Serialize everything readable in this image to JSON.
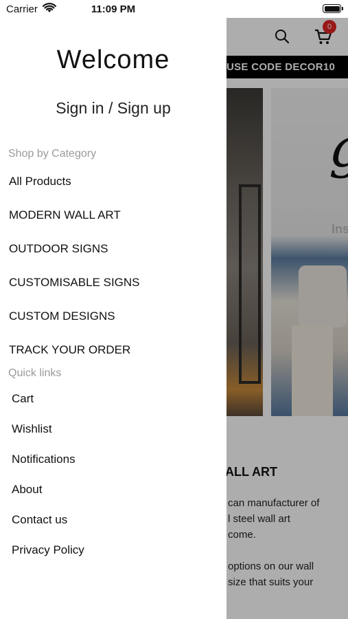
{
  "status_bar": {
    "carrier": "Carrier",
    "time": "11:09 PM"
  },
  "drawer": {
    "welcome": "Welcome",
    "signin": "Sign in / Sign up",
    "shop_by_category_title": "Shop by Category",
    "categories": [
      "All Products",
      "MODERN WALL ART",
      "OUTDOOR SIGNS",
      "CUSTOMISABLE SIGNS",
      "CUSTOM DESIGNS",
      "TRACK YOUR ORDER"
    ],
    "quick_links_title": "Quick links",
    "quick_links": [
      "Cart",
      "Wishlist",
      "Notifications",
      "About",
      "Contact us",
      "Privacy Policy"
    ]
  },
  "background_page": {
    "cart_count": "0",
    "promo": "USE CODE DECOR10",
    "banner_text": "Ins",
    "heading": "ALL ART",
    "paragraph1_lines": [
      "can manufacturer of",
      "l steel wall art",
      " come."
    ],
    "paragraph2_lines": [
      " options on our wall",
      "size that suits your"
    ]
  },
  "colors": {
    "badge": "#e02424",
    "promo_bar": "#000000",
    "section_title": "#9a9a9a"
  }
}
